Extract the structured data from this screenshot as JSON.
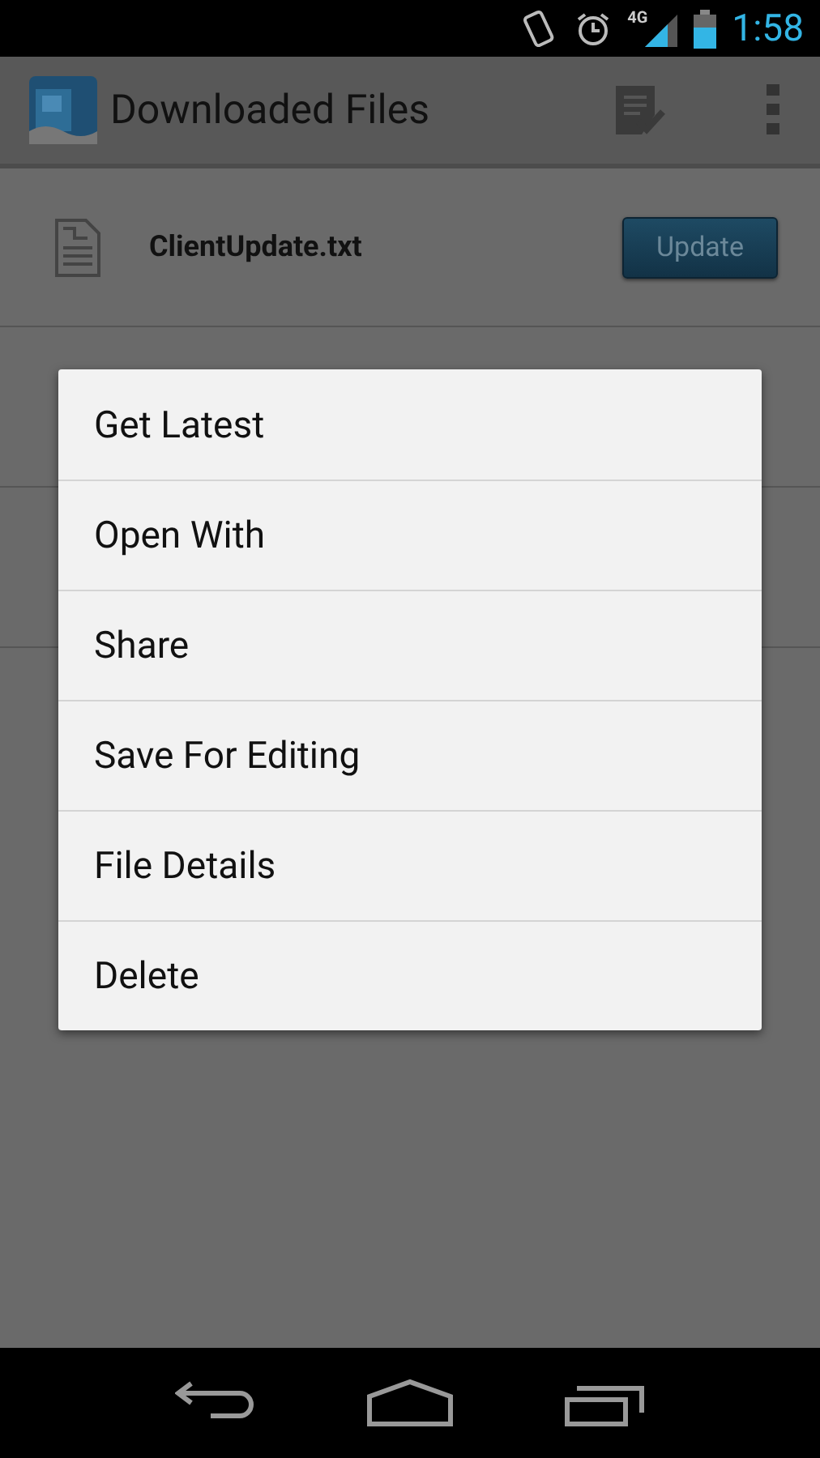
{
  "status_bar": {
    "time": "1:58",
    "network": "4G"
  },
  "action_bar": {
    "title": "Downloaded Files"
  },
  "files": [
    {
      "name": "ClientUpdate.txt",
      "action": "Update"
    }
  ],
  "context_menu": {
    "items": [
      {
        "label": "Get Latest"
      },
      {
        "label": "Open With"
      },
      {
        "label": "Share"
      },
      {
        "label": "Save For Editing"
      },
      {
        "label": "File Details"
      },
      {
        "label": "Delete"
      }
    ]
  }
}
